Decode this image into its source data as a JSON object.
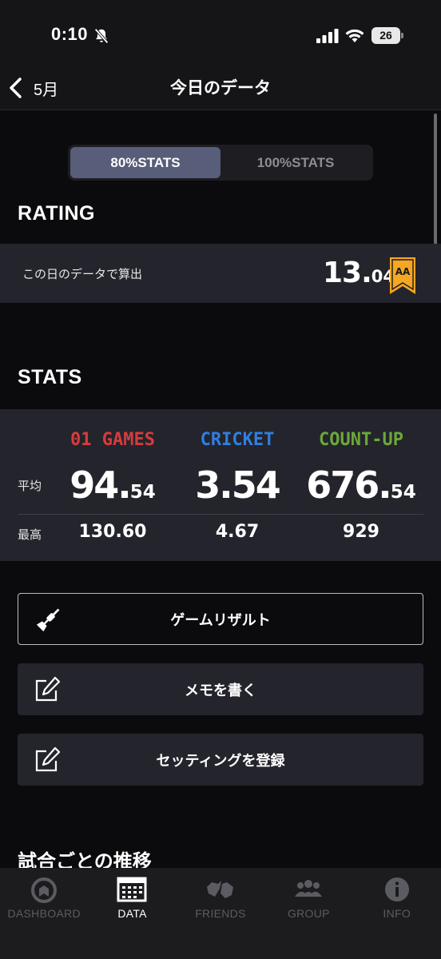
{
  "status_bar": {
    "time": "0:10",
    "battery": "26"
  },
  "nav": {
    "back_label": "5月",
    "title": "今日のデータ"
  },
  "segment": {
    "items": [
      {
        "label": "80%STATS",
        "active": true
      },
      {
        "label": "100%STATS",
        "active": false
      }
    ]
  },
  "rating": {
    "section_title": "RATING",
    "label": "この日のデータで算出",
    "value_int": "13.",
    "value_dec": "04",
    "class_badge": "AA",
    "badge_color": "#f5a623"
  },
  "stats": {
    "section_title": "STATS",
    "row_avg_label": "平均",
    "row_max_label": "最高",
    "columns": [
      {
        "header": "01 GAMES",
        "color": "#d63c3c",
        "avg_int": "94.",
        "avg_dec": "54",
        "max": "130.60"
      },
      {
        "header": "CRICKET",
        "color": "#2f7fe0",
        "avg_int": "3.54",
        "avg_dec": "",
        "max": "4.67"
      },
      {
        "header": "COUNT-UP",
        "color": "#6ba83a",
        "avg_int": "676.",
        "avg_dec": "54",
        "max": "929"
      }
    ]
  },
  "actions": {
    "game_result": "ゲームリザルト",
    "write_memo": "メモを書く",
    "register_setting": "セッティングを登録"
  },
  "trend": {
    "title": "試合ごとの推移"
  },
  "tab_bar": {
    "tabs": [
      {
        "label": "DASHBOARD",
        "icon": "dashboard-icon",
        "active": false
      },
      {
        "label": "DATA",
        "icon": "calendar-icon",
        "active": true
      },
      {
        "label": "FRIENDS",
        "icon": "friends-icon",
        "active": false
      },
      {
        "label": "GROUP",
        "icon": "group-icon",
        "active": false
      },
      {
        "label": "INFO",
        "icon": "info-icon",
        "active": false
      }
    ]
  }
}
